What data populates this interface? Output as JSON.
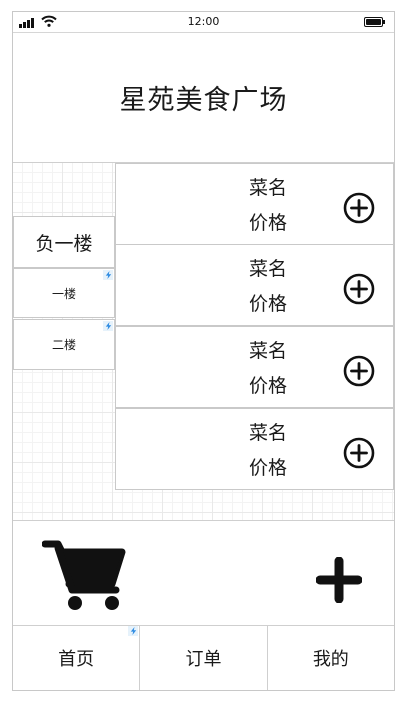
{
  "status_bar": {
    "time": "12:00"
  },
  "header": {
    "title": "星苑美食广场"
  },
  "floors": [
    {
      "label": "负一楼",
      "active": true
    },
    {
      "label": "一楼",
      "active": false
    },
    {
      "label": "二楼",
      "active": false
    }
  ],
  "dishes": [
    {
      "name": "菜名",
      "price": "价格"
    },
    {
      "name": "菜名",
      "price": "价格"
    },
    {
      "name": "菜名",
      "price": "价格"
    },
    {
      "name": "菜名",
      "price": "价格"
    }
  ],
  "cart": {
    "icon": "shopping-cart-icon",
    "add_icon": "plus-icon"
  },
  "tabs": [
    {
      "label": "首页"
    },
    {
      "label": "订单"
    },
    {
      "label": "我的"
    }
  ],
  "colors": {
    "text": "#1a1a1a",
    "border": "#c9c9c9",
    "badge": "#e6f2fb",
    "badge_bolt": "#2b8ae2"
  }
}
